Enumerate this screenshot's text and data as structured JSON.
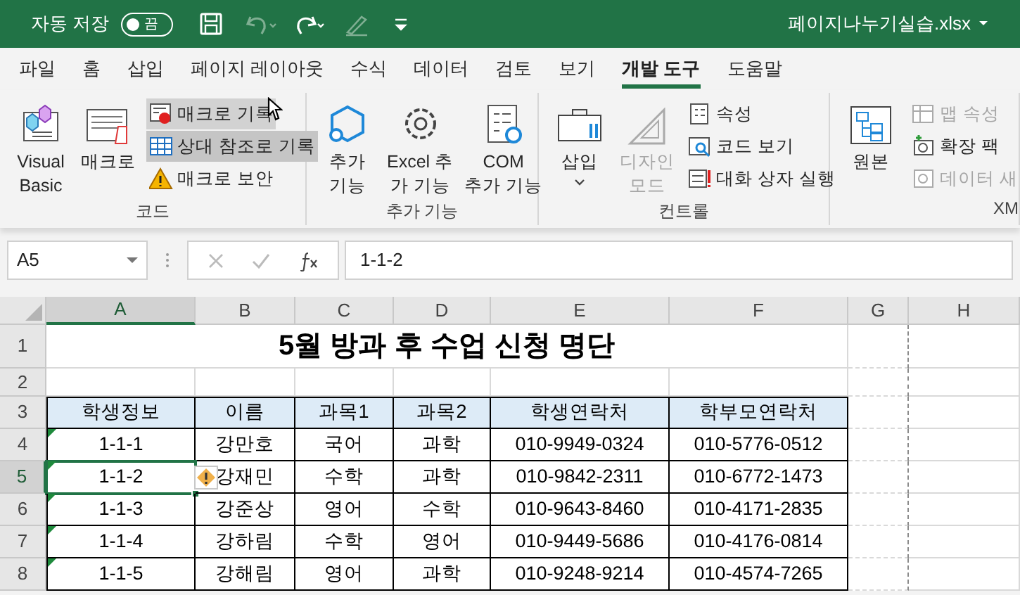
{
  "title_bar": {
    "autosave_label": "자동 저장",
    "autosave_toggle": {
      "text": "끔",
      "on": false
    },
    "undo_disabled": true,
    "redo_disabled": false,
    "draw_disabled": true,
    "file_name": "페이지나누기실습.xlsx"
  },
  "tabs": [
    {
      "label": "파일",
      "selected": false
    },
    {
      "label": "홈",
      "selected": false
    },
    {
      "label": "삽입",
      "selected": false
    },
    {
      "label": "페이지 레이아웃",
      "selected": false
    },
    {
      "label": "수식",
      "selected": false
    },
    {
      "label": "데이터",
      "selected": false
    },
    {
      "label": "검토",
      "selected": false
    },
    {
      "label": "보기",
      "selected": false
    },
    {
      "label": "개발 도구",
      "selected": true
    },
    {
      "label": "도움말",
      "selected": false
    }
  ],
  "ribbon_groups": [
    {
      "label": "코드",
      "items": [
        {
          "kind": "large",
          "lines": [
            "Visual",
            "Basic"
          ],
          "disabled": false
        },
        {
          "kind": "large",
          "lines": [
            "매크로"
          ],
          "disabled": false
        },
        {
          "kind": "small",
          "label": "매크로 기록",
          "disabled": false,
          "hovered": true,
          "selected": false
        },
        {
          "kind": "small",
          "label": "상대 참조로 기록",
          "disabled": false,
          "hovered": false,
          "selected": true
        },
        {
          "kind": "small",
          "label": "매크로 보안",
          "disabled": false,
          "hovered": false,
          "selected": false
        }
      ]
    },
    {
      "label": "추가 기능",
      "items": [
        {
          "kind": "large",
          "lines": [
            "추가",
            "기능"
          ],
          "disabled": false
        },
        {
          "kind": "large",
          "lines": [
            "Excel 추",
            "가 기능"
          ],
          "disabled": false
        },
        {
          "kind": "large",
          "lines": [
            "COM",
            "추가 기능"
          ],
          "disabled": false
        }
      ]
    },
    {
      "label": "컨트롤",
      "items": [
        {
          "kind": "large",
          "lines": [
            "삽입"
          ],
          "dropdown": true,
          "disabled": false
        },
        {
          "kind": "large",
          "lines": [
            "디자인",
            "모드"
          ],
          "disabled": true
        },
        {
          "kind": "small",
          "label": "속성",
          "disabled": false,
          "hovered": false,
          "selected": false
        },
        {
          "kind": "small",
          "label": "코드 보기",
          "disabled": false,
          "hovered": false,
          "selected": false
        },
        {
          "kind": "small",
          "label": "대화 상자 실행",
          "disabled": false,
          "hovered": false,
          "selected": false
        }
      ]
    },
    {
      "label": "XM",
      "items": [
        {
          "kind": "large",
          "lines": [
            "원본"
          ],
          "disabled": false
        },
        {
          "kind": "small",
          "label": "맵 속성",
          "disabled": true,
          "hovered": false,
          "selected": false
        },
        {
          "kind": "small",
          "label": "확장 팩",
          "disabled": false,
          "hovered": false,
          "selected": false
        },
        {
          "kind": "small",
          "label": "데이터 새",
          "disabled": true,
          "hovered": false,
          "selected": false
        }
      ]
    }
  ],
  "formula_bar": {
    "name_box": "A5",
    "formula": "1-1-2"
  },
  "sheet": {
    "columns": [
      {
        "label": "A",
        "selected": true
      },
      {
        "label": "B",
        "selected": false
      },
      {
        "label": "C",
        "selected": false
      },
      {
        "label": "D",
        "selected": false
      },
      {
        "label": "E",
        "selected": false
      },
      {
        "label": "F",
        "selected": false
      },
      {
        "label": "G",
        "selected": false
      },
      {
        "label": "H",
        "selected": false
      }
    ],
    "title_row": {
      "number": "1",
      "selected": false,
      "title": "5월 방과 후 수업 신청 명단"
    },
    "empty_row": {
      "number": "2",
      "selected": false
    },
    "header_row": {
      "number": "3",
      "selected": false,
      "cells": [
        "학생정보",
        "이름",
        "과목1",
        "과목2",
        "학생연락처",
        "학부모연락처"
      ]
    },
    "rows": [
      {
        "number": "4",
        "selected": false,
        "text_marker": true,
        "error_icon": false,
        "cells": [
          "1-1-1",
          "강만호",
          "국어",
          "과학",
          "010-9949-0324",
          "010-5776-0512"
        ]
      },
      {
        "number": "5",
        "selected": true,
        "text_marker": true,
        "error_icon": true,
        "cells": [
          "1-1-2",
          "강재민",
          "수학",
          "과학",
          "010-9842-2311",
          "010-6772-1473"
        ]
      },
      {
        "number": "6",
        "selected": false,
        "text_marker": true,
        "error_icon": false,
        "cells": [
          "1-1-3",
          "강준상",
          "영어",
          "수학",
          "010-9643-8460",
          "010-4171-2835"
        ]
      },
      {
        "number": "7",
        "selected": false,
        "text_marker": true,
        "error_icon": false,
        "cells": [
          "1-1-4",
          "강하림",
          "수학",
          "영어",
          "010-9449-5686",
          "010-4176-0814"
        ]
      },
      {
        "number": "8",
        "selected": false,
        "text_marker": true,
        "error_icon": false,
        "cells": [
          "1-1-5",
          "강해림",
          "영어",
          "과학",
          "010-9248-9214",
          "010-4574-7265"
        ]
      }
    ]
  }
}
